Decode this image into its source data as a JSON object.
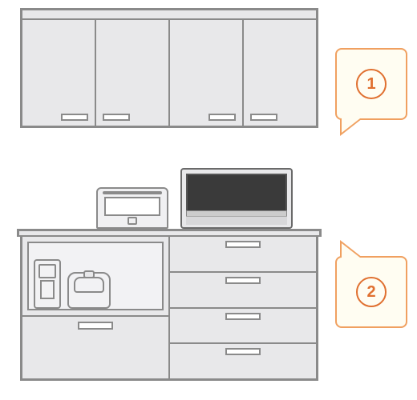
{
  "callouts": {
    "upper": {
      "label": "1"
    },
    "lower": {
      "label": "2"
    }
  },
  "colors": {
    "accent": "#e07030",
    "callout_border": "#f0a060",
    "callout_bg": "#fffdf2",
    "line": "#8a8a8a",
    "fill": "#e8e8ea"
  }
}
